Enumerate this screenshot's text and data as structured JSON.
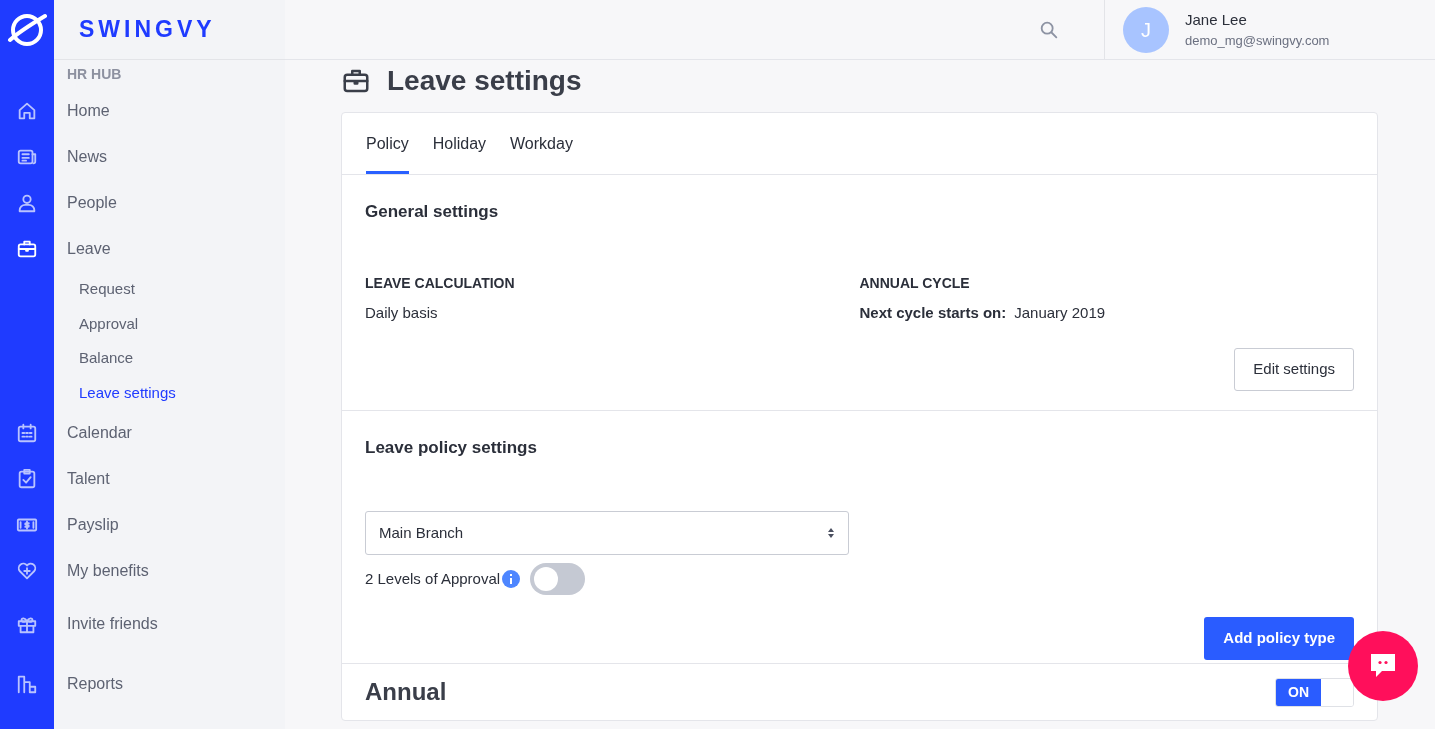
{
  "brand": {
    "name": "SWINGVY"
  },
  "header": {
    "user": {
      "initial": "J",
      "name": "Jane Lee",
      "email": "demo_mg@swingvy.com"
    }
  },
  "sidebar": {
    "section": "HR HUB",
    "items": [
      {
        "label": "Home",
        "expanded": false
      },
      {
        "label": "News",
        "expanded": false
      },
      {
        "label": "People",
        "expanded": false
      },
      {
        "label": "Leave",
        "expanded": true,
        "children": [
          {
            "label": "Request",
            "selected": false
          },
          {
            "label": "Approval",
            "selected": false
          },
          {
            "label": "Balance",
            "selected": false
          },
          {
            "label": "Leave settings",
            "selected": true
          }
        ]
      },
      {
        "label": "Calendar",
        "expanded": false
      },
      {
        "label": "Talent",
        "expanded": false
      },
      {
        "label": "Payslip",
        "expanded": false
      },
      {
        "label": "My benefits",
        "expanded": false
      },
      {
        "label": "Invite friends",
        "expanded": false
      },
      {
        "label": "Reports",
        "expanded": false
      }
    ]
  },
  "page": {
    "title": "Leave settings"
  },
  "tabs": [
    {
      "label": "Policy",
      "selected": true
    },
    {
      "label": "Holiday",
      "selected": false
    },
    {
      "label": "Workday",
      "selected": false
    }
  ],
  "general_settings": {
    "title": "General settings",
    "fields": [
      {
        "label": "LEAVE CALCULATION",
        "value": "Daily basis"
      },
      {
        "label": "ANNUAL CYCLE",
        "value_label": "Next cycle starts on:",
        "value": "January 2019"
      }
    ],
    "button": "Edit settings"
  },
  "leave_policy_settings": {
    "title": "Leave policy settings",
    "branch_select": {
      "value": "Main Branch"
    },
    "approval": {
      "label": "2 Levels of Approval",
      "on": false
    },
    "button": "Add policy type"
  },
  "policies": [
    {
      "name": "Annual",
      "toggle": {
        "label": "ON",
        "on": true
      }
    }
  ]
}
